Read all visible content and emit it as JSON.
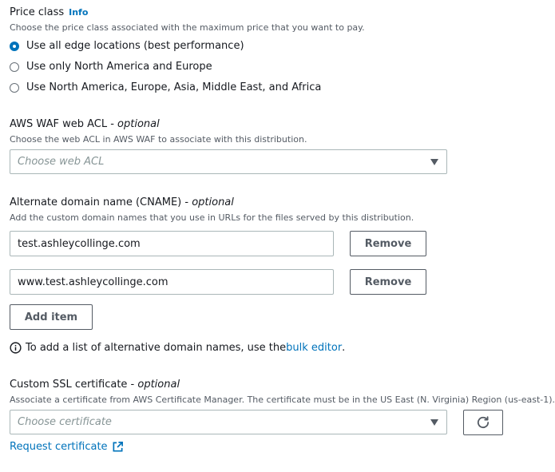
{
  "price_class": {
    "label": "Price class",
    "info": "Info",
    "description": "Choose the price class associated with the maximum price that you want to pay.",
    "options": [
      {
        "label": "Use all edge locations (best performance)",
        "checked": true
      },
      {
        "label": "Use only North America and Europe",
        "checked": false
      },
      {
        "label": "Use North America, Europe, Asia, Middle East, and Africa",
        "checked": false
      }
    ]
  },
  "waf": {
    "label": "AWS WAF web ACL - ",
    "optional": "optional",
    "description": "Choose the web ACL in AWS WAF to associate with this distribution.",
    "placeholder": "Choose web ACL"
  },
  "cname": {
    "label": "Alternate domain name (CNAME) - ",
    "optional": "optional",
    "description": "Add the custom domain names that you use in URLs for the files served by this distribution.",
    "items": [
      {
        "value": "test.ashleycollinge.com",
        "remove_label": "Remove"
      },
      {
        "value": "www.test.ashleycollinge.com",
        "remove_label": "Remove"
      }
    ],
    "add_label": "Add item",
    "hint_prefix": "To add a list of alternative domain names, use the ",
    "hint_link": "bulk editor",
    "hint_suffix": "."
  },
  "ssl": {
    "label": "Custom SSL certificate - ",
    "optional": "optional",
    "description": "Associate a certificate from AWS Certificate Manager. The certificate must be in the US East (N. Virginia) Region (us-east-1).",
    "placeholder": "Choose certificate",
    "request_link": "Request certificate"
  },
  "colors": {
    "accent": "#0073bb",
    "text": "#16191f",
    "muted": "#545b64",
    "border": "#aab7b8"
  }
}
